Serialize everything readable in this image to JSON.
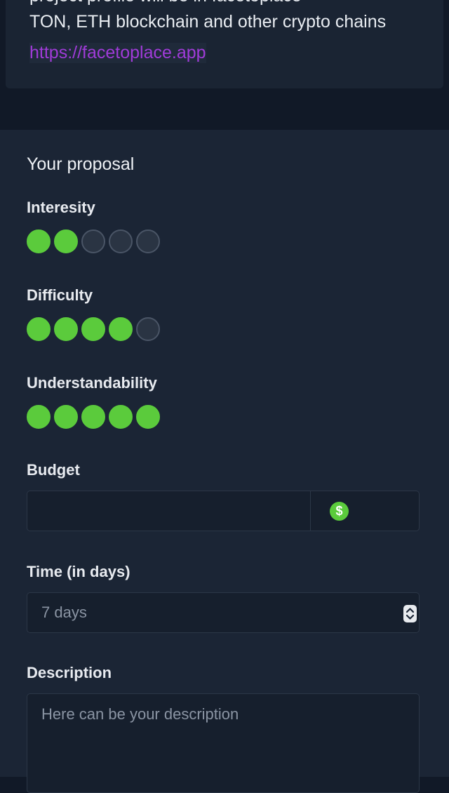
{
  "app": {
    "description_clipped": "project profile will be in facetoplace",
    "description": "TON, ETH blockchain and other crypto chains",
    "link": "https://facetoplace.app"
  },
  "form": {
    "title": "Your proposal",
    "ratings": [
      {
        "label": "Interesity",
        "value": 2,
        "max": 5
      },
      {
        "label": "Difficulty",
        "value": 4,
        "max": 5
      },
      {
        "label": "Understandability",
        "value": 5,
        "max": 5
      }
    ],
    "budget": {
      "label": "Budget",
      "value": "",
      "currency_icon": "dollar-icon",
      "currency_symbol": "$"
    },
    "time": {
      "label": "Time (in days)",
      "value": "",
      "placeholder": "7 days"
    },
    "description": {
      "label": "Description",
      "value": "",
      "placeholder": "Here can be your description"
    }
  },
  "colors": {
    "background": "#111927",
    "card": "#1b2535",
    "accent_green": "#5bcb3c",
    "link_purple": "#a03bd8"
  }
}
